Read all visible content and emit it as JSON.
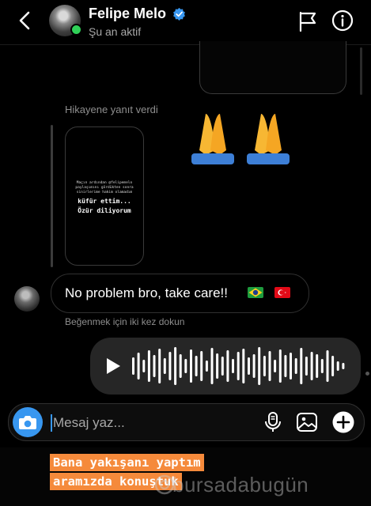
{
  "header": {
    "name": "Felipe Melo",
    "status": "Şu an aktif",
    "verified_color": "#3897f0",
    "online_color": "#30d158"
  },
  "thread": {
    "story_reply_label": "Hikayene yanıt verdi",
    "story_text_small": "Maçın ardından @felipemelo\npaylaşımını gördükten sonra\nsinirlerime hakim olamadım",
    "story_text_big": "küfür ettim...\nÖzür diliyorum",
    "reaction_emojis": "🙏🙏",
    "incoming_message": "No problem bro, take care!!",
    "like_hint": "Beğenmek için iki kez dokun",
    "voice_message": {
      "play_icon": "play-icon"
    }
  },
  "composer": {
    "placeholder": "Mesaj yaz...",
    "accent": "#3897f0"
  },
  "caption": {
    "line1": "Bana yakışanı yaptım",
    "line2": "aramızda konuştuk",
    "highlight_color": "#f58a3b"
  },
  "watermark": "bursadabugün"
}
